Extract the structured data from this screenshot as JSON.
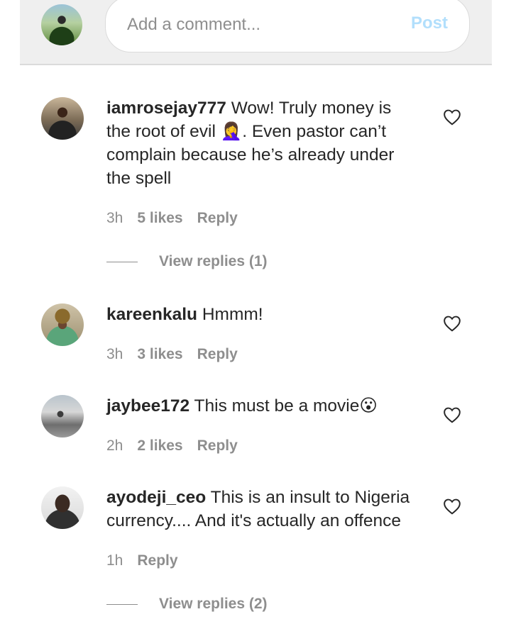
{
  "composer": {
    "placeholder": "Add a comment...",
    "post_label": "Post"
  },
  "comments": [
    {
      "username": "iamrosejay777",
      "text": "Wow! Truly money is the root of evil 🤦‍♀️. Even pastor can’t complain because he’s already under the spell",
      "time": "3h",
      "likes": "5 likes",
      "reply_label": "Reply",
      "view_replies": "View replies (1)"
    },
    {
      "username": "kareenkalu",
      "text": "Hmmm!",
      "time": "3h",
      "likes": "3 likes",
      "reply_label": "Reply"
    },
    {
      "username": "jaybee172",
      "text": "This must be a movie😮",
      "time": "2h",
      "likes": "2 likes",
      "reply_label": "Reply"
    },
    {
      "username": "ayodeji_ceo",
      "text": "This is an insult to Nigeria currency.... And it's actually an offence",
      "time": "1h",
      "reply_label": "Reply",
      "view_replies": "View replies (2)"
    }
  ],
  "icons": {
    "like": "heart-outline-icon"
  }
}
